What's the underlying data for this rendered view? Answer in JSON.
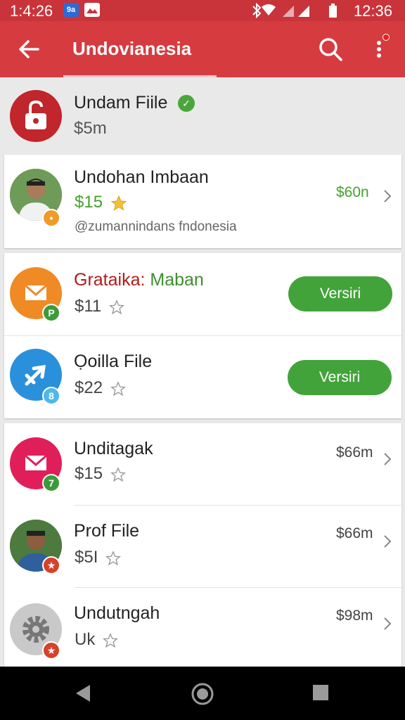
{
  "status_bar": {
    "time_left": "1:4:26",
    "time_right": "12:36",
    "notif_1": "9a",
    "icons": [
      "bluetooth-icon",
      "wifi-icon",
      "signal-icon",
      "signal-icon",
      "battery-icon"
    ]
  },
  "app_bar": {
    "title": "Undovianesia",
    "color": "#d63b40"
  },
  "items": [
    {
      "name": "Undam Fiile",
      "price": "$5m"
    },
    {
      "name": "Undohan Imbaan",
      "price": "$15",
      "handle": "@zumannindans fndonesia",
      "right_price": "$60n"
    },
    {
      "name_part1": "Grataika:",
      "name_part2": "Maban",
      "price": "$11",
      "badge": "P",
      "button": "Versiri"
    },
    {
      "name": "Ọoilla File",
      "price": "$22",
      "badge": "8",
      "button": "Versiri"
    },
    {
      "name": "Unditagak",
      "price": "$15",
      "badge": "7",
      "right_price": "$66m"
    },
    {
      "name": "Prof File",
      "price": "$5I",
      "right_price": "$66m"
    },
    {
      "name": "Undutngah",
      "price": "Uk",
      "right_price": "$98m"
    }
  ],
  "colors": {
    "accent": "#d63b40",
    "green": "#43a33b"
  }
}
